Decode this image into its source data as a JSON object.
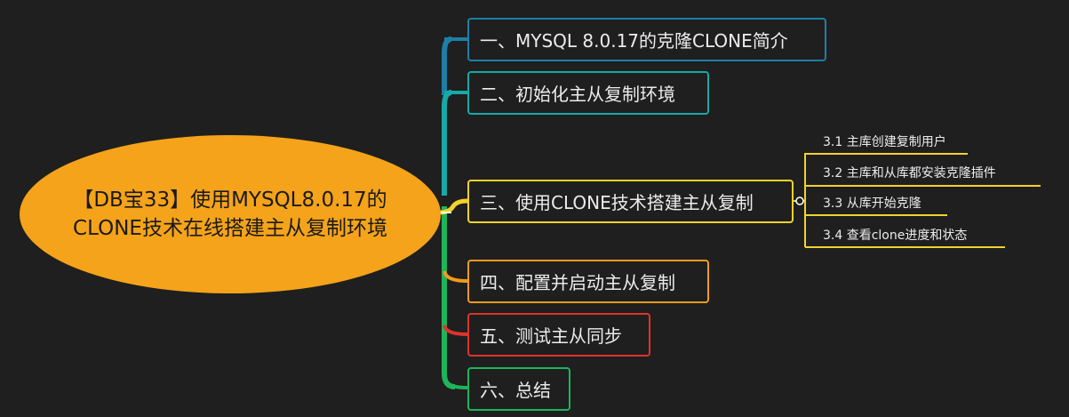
{
  "root": {
    "label": "【DB宝33】使用MYSQL8.0.17的CLONE技术在线搭建主从复制环境"
  },
  "branches": [
    {
      "label": "一、MYSQL 8.0.17的克隆CLONE简介",
      "color": "#1e7fa6"
    },
    {
      "label": "二、初始化主从复制环境",
      "color": "#18a8a8"
    },
    {
      "label": "三、使用CLONE技术搭建主从复制",
      "color": "#f2d22b"
    },
    {
      "label": "四、配置并启动主从复制",
      "color": "#f39a1c"
    },
    {
      "label": "五、测试主从同步",
      "color": "#e0332b"
    },
    {
      "label": "六、总结",
      "color": "#1fb45a"
    }
  ],
  "subtopics": [
    {
      "label": "3.1 主库创建复制用户"
    },
    {
      "label": "3.2 主库和从库都安装克隆插件"
    },
    {
      "label": "3.3 从库开始克隆"
    },
    {
      "label": "3.4 查看clone进度和状态"
    }
  ],
  "colors": {
    "background": "#1f1f1f",
    "root": "#f5a31a",
    "sub_line": "#f2d22b"
  }
}
